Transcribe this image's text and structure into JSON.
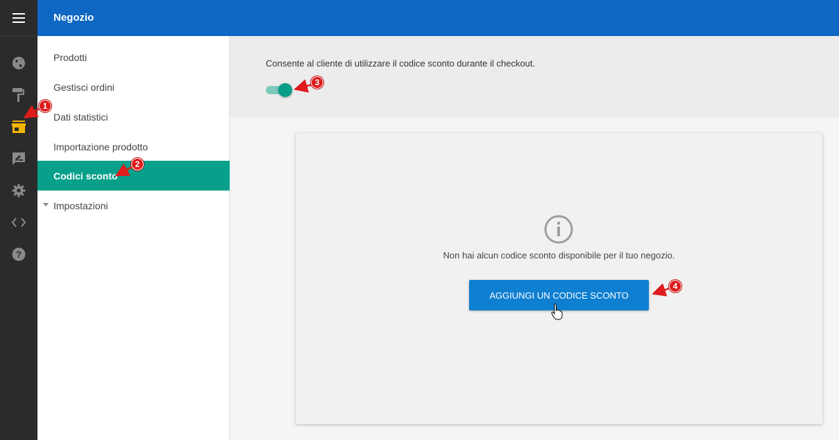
{
  "app": {
    "section_title": "Negozio"
  },
  "rail": {
    "icons": [
      {
        "name": "menu-icon"
      },
      {
        "name": "globe-icon"
      },
      {
        "name": "paint-roller-icon"
      },
      {
        "name": "store-icon",
        "active": true,
        "color": "#f5b400"
      },
      {
        "name": "edit-message-icon"
      },
      {
        "name": "gear-icon"
      },
      {
        "name": "code-icon"
      },
      {
        "name": "help-icon"
      }
    ]
  },
  "subnav": {
    "items": [
      {
        "label": "Prodotti"
      },
      {
        "label": "Gestisci ordini"
      },
      {
        "label": "Dati statistici"
      },
      {
        "label": "Importazione prodotto"
      },
      {
        "label": "Codici sconto",
        "active": true
      },
      {
        "label": "Impostazioni",
        "collapsible": true
      }
    ]
  },
  "settings": {
    "description": "Consente al cliente di utilizzare il codice sconto durante il checkout.",
    "toggle_on": true
  },
  "empty_state": {
    "message": "Non hai alcun codice sconto disponibile per il tuo negozio.",
    "button_label": "AGGIUNGI UN CODICE SCONTO"
  },
  "annotations": [
    "1",
    "2",
    "3",
    "4"
  ],
  "colors": {
    "topbar": "#0d67c3",
    "rail": "#2b2b2b",
    "active_item": "#07a08b",
    "button": "#0e7fd1",
    "annotation": "#e01b1b"
  }
}
